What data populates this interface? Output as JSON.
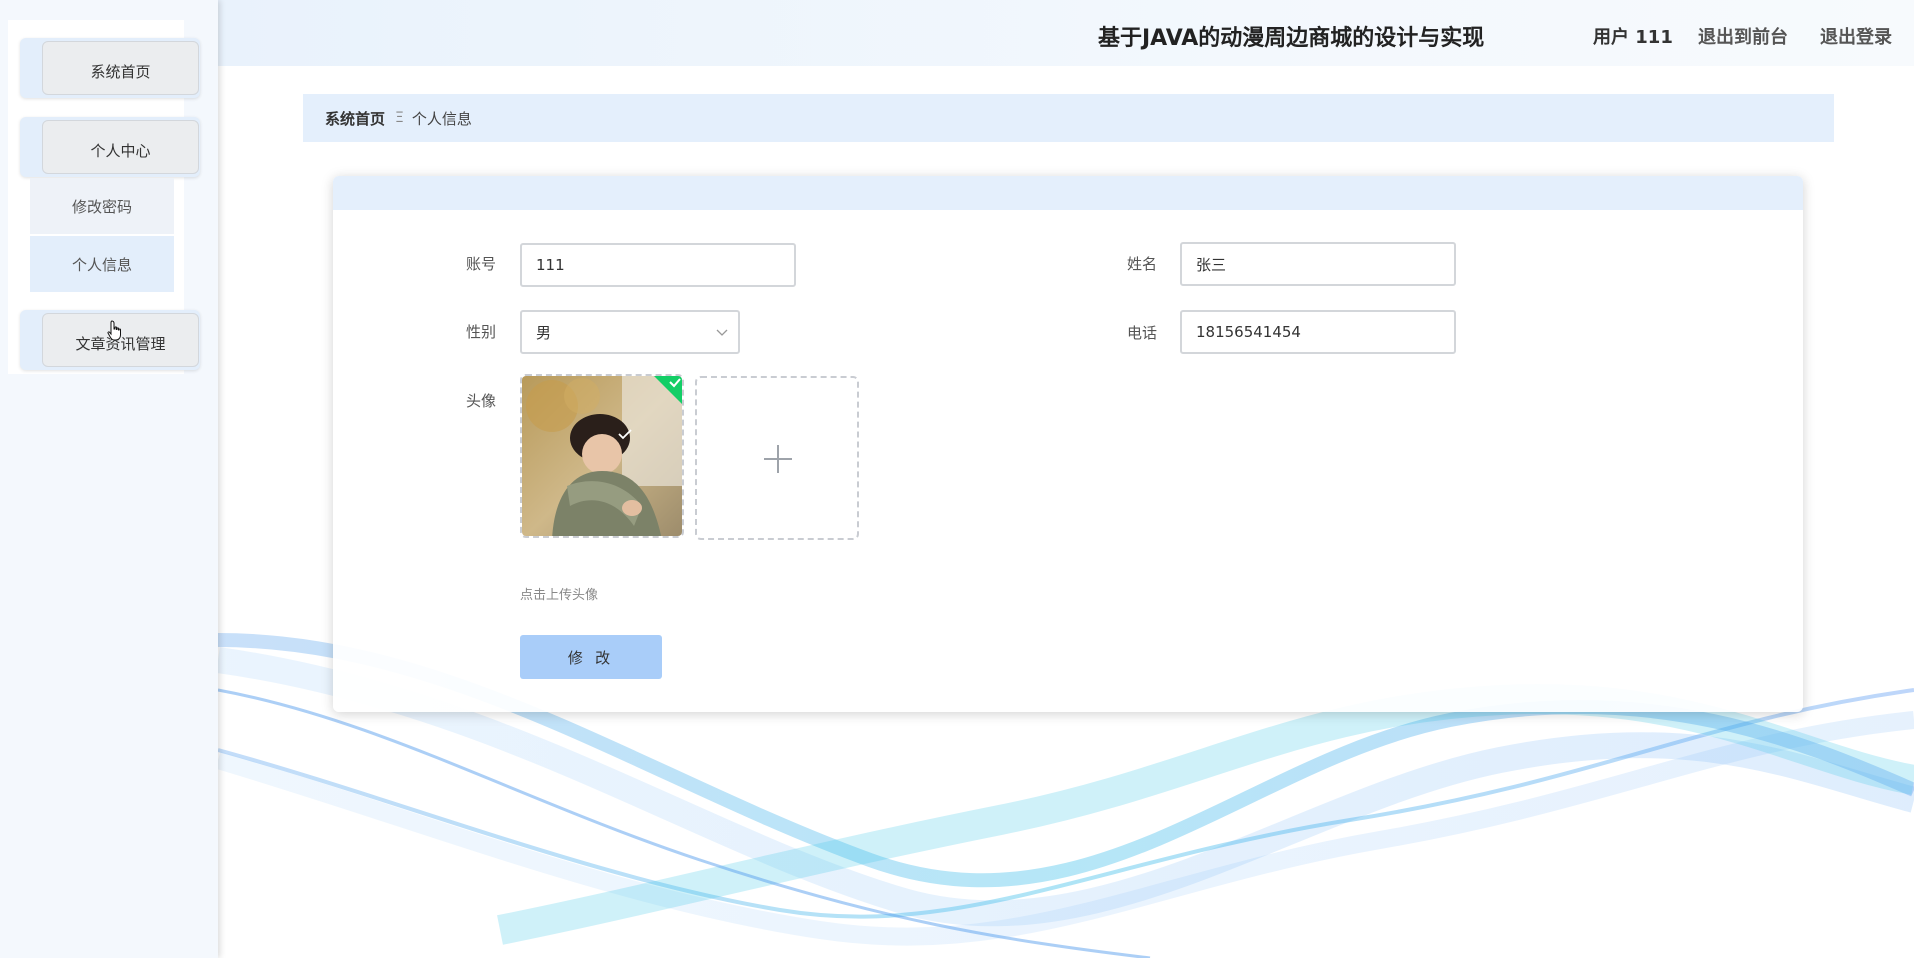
{
  "app": {
    "title": "基于JAVA的动漫周边商城的设计与实现"
  },
  "header": {
    "user_label": "用户 111",
    "front_link": "退出到前台",
    "logout_link": "退出登录"
  },
  "sidebar": {
    "home": "系统首页",
    "personal_center": "个人中心",
    "sub_items": [
      "修改密码",
      "个人信息"
    ],
    "article_mgmt": "文章资讯管理"
  },
  "breadcrumb": {
    "home": "系统首页",
    "separator": "Ξ",
    "current": "个人信息"
  },
  "form": {
    "account_label": "账号",
    "account_value": "111",
    "name_label": "姓名",
    "name_value": "张三",
    "gender_label": "性别",
    "gender_value": "男",
    "phone_label": "电话",
    "phone_value": "18156541454",
    "avatar_label": "头像",
    "upload_hint": "点击上传头像",
    "submit_label": "修 改"
  },
  "colors": {
    "accent": "#a9cdf9",
    "header_bg": "#e9f2fc",
    "breadcrumb_bg": "#e4effc",
    "success_badge": "#13ce66"
  }
}
